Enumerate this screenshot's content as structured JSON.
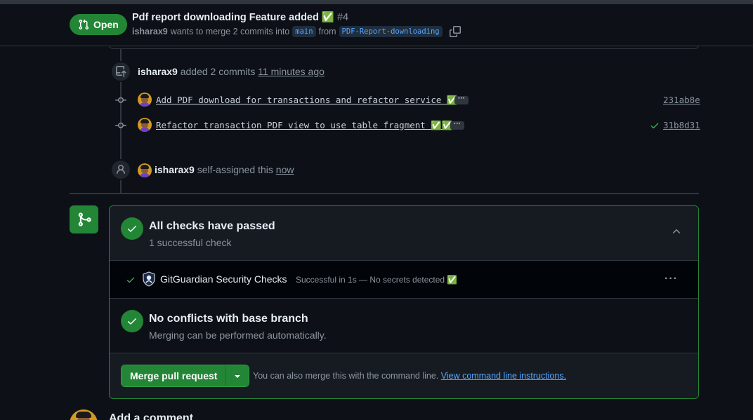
{
  "header": {
    "state_label": "Open",
    "title": "Pdf report downloading Feature added ✅",
    "number": "#4",
    "author": "isharax9",
    "merge_text": "wants to merge 2 commits into",
    "base_branch": "main",
    "from_text": "from",
    "head_branch": "PDF-Report-downloading"
  },
  "timeline": {
    "commits_event": {
      "author": "isharax9",
      "action": "added 2 commits",
      "time": "11 minutes ago"
    },
    "commits": [
      {
        "message": "Add PDF download for transactions and refactor service ✅",
        "more": "···",
        "sha": "231ab8e",
        "verified": false
      },
      {
        "message": "Refactor transaction PDF view to use table fragment ✅✅",
        "more": "···",
        "sha": "31b8d31",
        "verified": true
      }
    ],
    "assign_event": {
      "author": "isharax9",
      "action": "self-assigned this",
      "time": "now"
    }
  },
  "merge_box": {
    "checks_title": "All checks have passed",
    "checks_sub": "1 successful check",
    "check": {
      "name": "GitGuardian Security Checks",
      "description": "Successful in 1s — No secrets detected ✅",
      "more": "···"
    },
    "conflicts_title": "No conflicts with base branch",
    "conflicts_sub": "Merging can be performed automatically.",
    "merge_button": "Merge pull request",
    "merge_note": "You can also merge this with the command line.",
    "merge_link": "View command line instructions."
  },
  "comment": {
    "heading": "Add a comment"
  },
  "colors": {
    "background": "#0d1117",
    "success": "#238636",
    "link": "#58a6ff",
    "muted": "#8b949e",
    "border": "#30363d"
  }
}
